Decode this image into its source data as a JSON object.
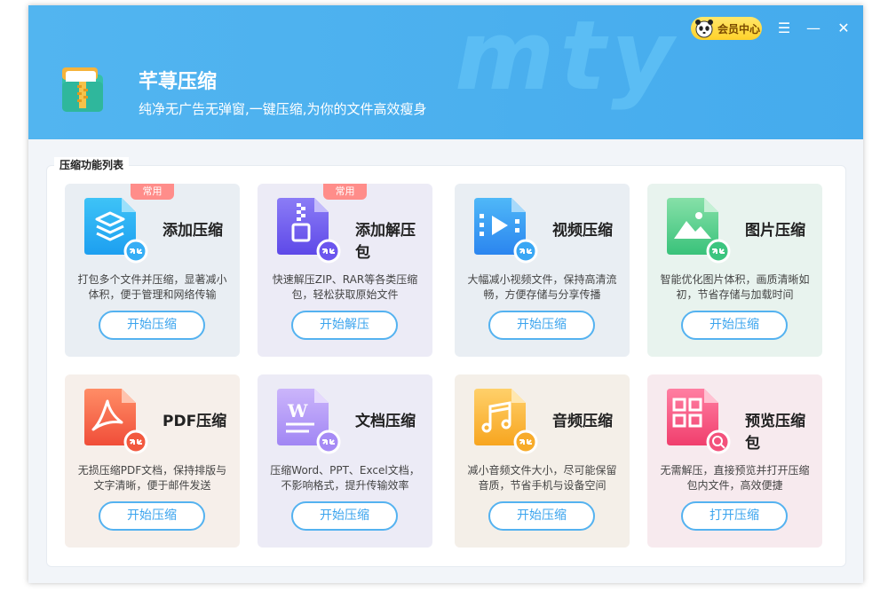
{
  "app": {
    "title": "芊荨压缩",
    "subtitle": "纯净无广告无弹窗,一键压缩,为你的文件高效瘦身",
    "watermark": "mty",
    "vip_label": "会员中心",
    "controls": {
      "menu": "☰",
      "minimize": "—",
      "close": "✕"
    }
  },
  "section_title": "压缩功能列表",
  "cards": [
    {
      "name": "添加压缩",
      "badge": "常用",
      "desc": "打包多个文件并压缩，显著减小体积，便于管理和网络传输",
      "button": "开始压缩",
      "icon": "layers-icon"
    },
    {
      "name": "添加解压包",
      "badge": "常用",
      "desc": "快速解压ZIP、RAR等各类压缩包，轻松获取原始文件",
      "button": "开始解压",
      "icon": "zip-icon"
    },
    {
      "name": "视频压缩",
      "badge": "",
      "desc": "大幅减小视频文件，保持高清流畅，方便存储与分享传播",
      "button": "开始压缩",
      "icon": "video-icon"
    },
    {
      "name": "图片压缩",
      "badge": "",
      "desc": "智能优化图片体积，画质清晰如初，节省存储与加载时间",
      "button": "开始压缩",
      "icon": "image-icon"
    },
    {
      "name": "PDF压缩",
      "badge": "",
      "desc": "无损压缩PDF文档，保持排版与文字清晰，便于邮件发送",
      "button": "开始压缩",
      "icon": "pdf-icon"
    },
    {
      "name": "文档压缩",
      "badge": "",
      "desc": "压缩Word、PPT、Excel文档，不影响格式，提升传输效率",
      "button": "开始压缩",
      "icon": "document-icon"
    },
    {
      "name": "音频压缩",
      "badge": "",
      "desc": "减小音频文件大小，尽可能保留音质，节省手机与设备空间",
      "button": "开始压缩",
      "icon": "music-icon"
    },
    {
      "name": "预览压缩包",
      "badge": "",
      "desc": "无需解压，直接预览并打开压缩包内文件，高效便捷",
      "button": "打开压缩",
      "icon": "preview-icon"
    }
  ],
  "colors": {
    "header": "#4cb1ef",
    "accent": "#3ba4ee",
    "badge": "#ff8d8a"
  }
}
